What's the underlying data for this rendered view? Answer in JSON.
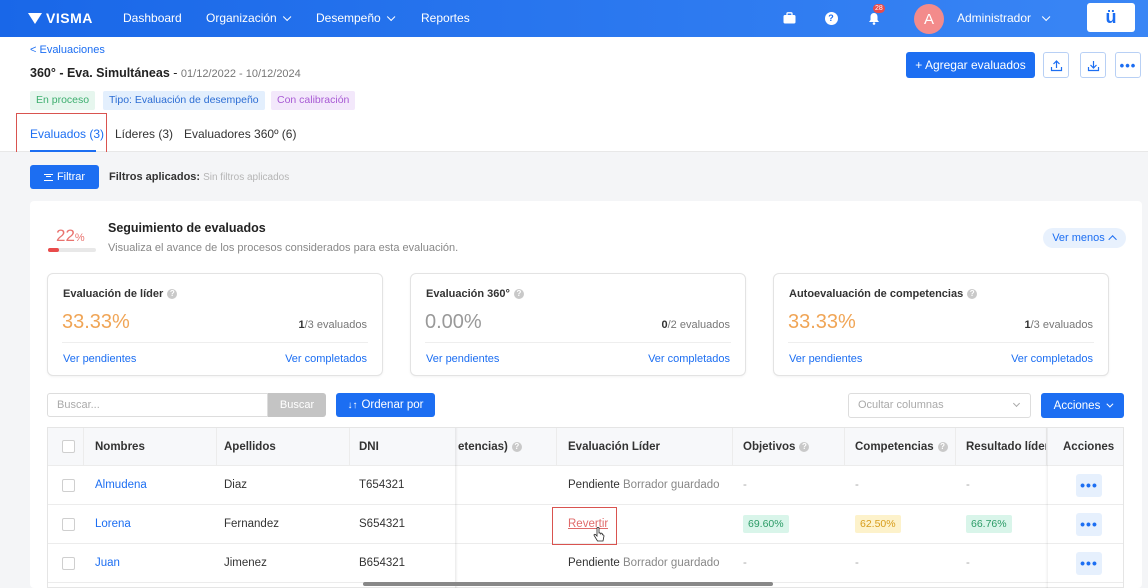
{
  "topbar": {
    "logo": "VISMA",
    "nav": [
      {
        "label": "Dashboard",
        "dropdown": false
      },
      {
        "label": "Organización",
        "dropdown": true
      },
      {
        "label": "Desempeño",
        "dropdown": true
      },
      {
        "label": "Reportes",
        "dropdown": false
      }
    ],
    "notification_count": "28",
    "avatar_initial": "A",
    "user_name": "Administrador",
    "brand_box": "ü",
    "colors": {
      "bar": "#1c6ef2",
      "avatar": "#f38b8b"
    }
  },
  "header": {
    "back_link": "< Evaluaciones",
    "title": "360° - Eva. Simultáneas",
    "separator": " - ",
    "dates": "01/12/2022 - 10/12/2024",
    "tags": [
      "En proceso",
      "Tipo: Evaluación de desempeño",
      "Con calibración"
    ],
    "add_button": "+ Agregar evaluados",
    "icon_buttons": [
      "upload-icon",
      "download-icon",
      "more-icon"
    ]
  },
  "tabs": [
    {
      "label": "Evaluados (3)",
      "active": true
    },
    {
      "label": "Líderes (3)",
      "active": false
    },
    {
      "label": "Evaluadores 360º (6)",
      "active": false
    }
  ],
  "filters": {
    "button": "Filtrar",
    "label": "Filtros aplicados:",
    "value": "Sin filtros aplicados"
  },
  "tracking": {
    "percent": "22",
    "percent_sign": "%",
    "progress": 0.22,
    "title": "Seguimiento de evaluados",
    "subtitle": "Visualiza el avance de los procesos considerados para esta evaluación.",
    "toggle": "Ver menos"
  },
  "stats": [
    {
      "title": "Evaluación de líder",
      "value": "33.33%",
      "count_done": "1",
      "count_rest": "/3 evaluados",
      "link_pending": "Ver pendientes",
      "link_done": "Ver completados"
    },
    {
      "title": "Evaluación 360°",
      "value": "0.00%",
      "count_done": "0",
      "count_rest": "/2 evaluados",
      "link_pending": "Ver pendientes",
      "link_done": "Ver completados"
    },
    {
      "title": "Autoevaluación de competencias",
      "value": "33.33%",
      "count_done": "1",
      "count_rest": "/3 evaluados",
      "link_pending": "Ver pendientes",
      "link_done": "Ver completados"
    }
  ],
  "toolbar": {
    "search_placeholder": "Buscar...",
    "search_button": "Buscar",
    "order_button": "Ordenar por",
    "columns_placeholder": "Ocultar columnas",
    "actions_button": "Acciones"
  },
  "table": {
    "headers": {
      "names": "Nombres",
      "surnames": "Apellidos",
      "dni": "DNI",
      "competencies_partial": "etencias)",
      "leader_eval": "Evaluación Líder",
      "objectives": "Objetivos",
      "competencies": "Competencias",
      "leader_result": "Resultado líder",
      "actions": "Acciones"
    },
    "rows": [
      {
        "name": "Almudena",
        "surname": "Diaz",
        "dni": "T654321",
        "status": "Pendiente",
        "status_note": "Borrador guardado",
        "revert": "",
        "objectives": "-",
        "competencies": "-",
        "result": "-"
      },
      {
        "name": "Lorena",
        "surname": "Fernandez",
        "dni": "S654321",
        "status": "",
        "status_note": "",
        "revert": "Revertir",
        "objectives": "69.60%",
        "competencies": "62.50%",
        "result": "66.76%"
      },
      {
        "name": "Juan",
        "surname": "Jimenez",
        "dni": "B654321",
        "status": "Pendiente",
        "status_note": "Borrador guardado",
        "revert": "",
        "objectives": "-",
        "competencies": "-",
        "result": "-"
      }
    ]
  }
}
